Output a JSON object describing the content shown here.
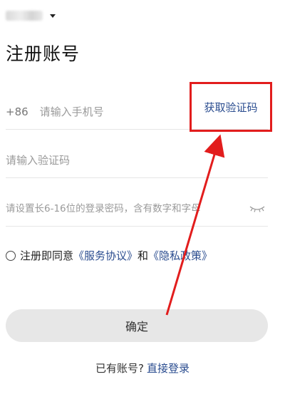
{
  "header": {
    "title": "注册账号"
  },
  "phone": {
    "country_code": "+86",
    "placeholder": "请输入手机号",
    "get_code_label": "获取验证码"
  },
  "verification": {
    "placeholder": "请输入验证码"
  },
  "password": {
    "placeholder": "请设置长6-16位的登录密码，含有数字和字母"
  },
  "agreement": {
    "prefix": "注册即同意",
    "terms_link": "《服务协议》",
    "and": "和",
    "privacy_link": "《隐私政策》"
  },
  "confirm_label": "确定",
  "login": {
    "prompt": "已有账号?",
    "link": "直接登录"
  },
  "colors": {
    "accent_link": "#2a4c8f",
    "annotation_red": "#e21d1d",
    "button_bg": "#e7e7e7"
  }
}
